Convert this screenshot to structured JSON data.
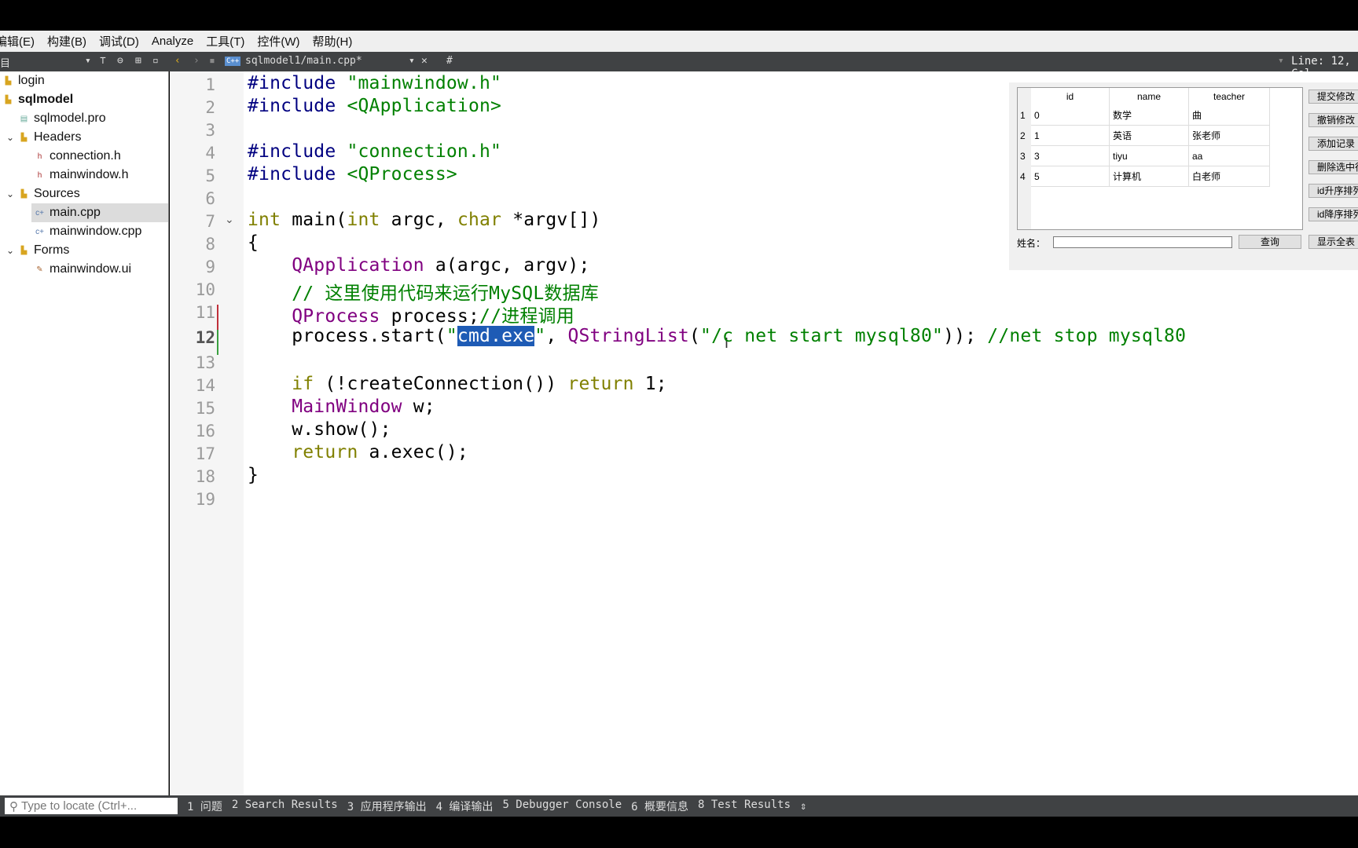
{
  "menu": [
    "编辑(E)",
    "构建(B)",
    "调试(D)",
    "Analyze",
    "工具(T)",
    "控件(W)",
    "帮助(H)"
  ],
  "toolbar": {
    "project_label": "目",
    "file_tab": "sqlmodel1/main.cpp*",
    "symbol": "#",
    "position": "Line: 12, Col"
  },
  "sidebar": {
    "items": [
      {
        "label": "login",
        "level": 0,
        "icon": "project-folder-icon"
      },
      {
        "label": "sqlmodel",
        "level": 0,
        "icon": "project-folder-icon",
        "bold": true
      },
      {
        "label": "sqlmodel.pro",
        "level": 1,
        "icon": "pro-file-icon"
      },
      {
        "label": "Headers",
        "level": 1,
        "icon": "folder-icon",
        "expanded": true
      },
      {
        "label": "connection.h",
        "level": 2,
        "icon": "header-file-icon"
      },
      {
        "label": "mainwindow.h",
        "level": 2,
        "icon": "header-file-icon"
      },
      {
        "label": "Sources",
        "level": 1,
        "icon": "folder-icon",
        "expanded": true
      },
      {
        "label": "main.cpp",
        "level": 2,
        "icon": "cpp-file-icon",
        "selected": true
      },
      {
        "label": "mainwindow.cpp",
        "level": 2,
        "icon": "cpp-file-icon"
      },
      {
        "label": "Forms",
        "level": 1,
        "icon": "folder-icon",
        "expanded": true
      },
      {
        "label": "mainwindow.ui",
        "level": 2,
        "icon": "ui-file-icon"
      }
    ]
  },
  "editor": {
    "current_line": 12,
    "lines": [
      [
        [
          "#include ",
          "pp"
        ],
        [
          "\"mainwindow.h\"",
          "st"
        ]
      ],
      [
        [
          "#include ",
          "pp"
        ],
        [
          "<QApplication>",
          "st"
        ]
      ],
      [],
      [
        [
          "#include ",
          "pp"
        ],
        [
          "\"connection.h\"",
          "st"
        ]
      ],
      [
        [
          "#include ",
          "pp"
        ],
        [
          "<QProcess>",
          "st"
        ]
      ],
      [],
      [
        [
          "int",
          "kw"
        ],
        [
          " main(",
          ""
        ],
        [
          "int",
          "kw"
        ],
        [
          " argc, ",
          ""
        ],
        [
          "char",
          "kw"
        ],
        [
          " *argv[])",
          ""
        ]
      ],
      [
        [
          "{",
          ""
        ]
      ],
      [
        [
          "    ",
          ""
        ],
        [
          "QApplication",
          "ty"
        ],
        [
          " a(argc, argv);",
          ""
        ]
      ],
      [
        [
          "    ",
          ""
        ],
        [
          "// 这里使用代码来运行MySQL数据库",
          "cm"
        ]
      ],
      [
        [
          "    ",
          ""
        ],
        [
          "QProcess",
          "ty"
        ],
        [
          " process;",
          ""
        ],
        [
          "//进程调用",
          "cm"
        ]
      ],
      [
        [
          "    process.start(",
          ""
        ],
        [
          "\"",
          "st"
        ],
        [
          "cmd.exe",
          "sel-hl"
        ],
        [
          "\"",
          "st"
        ],
        [
          ", ",
          ""
        ],
        [
          "QStringList",
          "ty"
        ],
        [
          "(",
          ""
        ],
        [
          "\"/c net start mysql80\"",
          "st"
        ],
        [
          ")); ",
          ""
        ],
        [
          "//net stop mysql80",
          "cm"
        ]
      ],
      [],
      [
        [
          "    ",
          ""
        ],
        [
          "if",
          "kw"
        ],
        [
          " (!createConnection()) ",
          ""
        ],
        [
          "return",
          "kw"
        ],
        [
          " 1;",
          ""
        ]
      ],
      [
        [
          "    ",
          ""
        ],
        [
          "MainWindow",
          "ty"
        ],
        [
          " w;",
          ""
        ]
      ],
      [
        [
          "    w.show();",
          ""
        ]
      ],
      [
        [
          "    ",
          ""
        ],
        [
          "return",
          "kw"
        ],
        [
          " a.exec();",
          ""
        ]
      ],
      [
        [
          "}",
          ""
        ]
      ],
      []
    ]
  },
  "app_window": {
    "columns": [
      "id",
      "name",
      "teacher"
    ],
    "rows": [
      [
        "0",
        "数学",
        "曲"
      ],
      [
        "1",
        "英语",
        "张老师"
      ],
      [
        "3",
        "tiyu",
        "aa"
      ],
      [
        "5",
        "计算机",
        "白老师"
      ]
    ],
    "buttons": [
      "提交修改",
      "撤销修改",
      "添加记录",
      "删除选中行",
      "id升序排列",
      "id降序排列"
    ],
    "name_label": "姓名：",
    "name_value": "",
    "query_button": "查询",
    "show_all_button": "显示全表"
  },
  "status": {
    "locate_placeholder": "Type to locate (Ctrl+...",
    "tabs": [
      "1 问题",
      "2 Search Results",
      "3 应用程序输出",
      "4 编译输出",
      "5 Debugger Console",
      "6 概要信息",
      "8 Test Results"
    ]
  }
}
